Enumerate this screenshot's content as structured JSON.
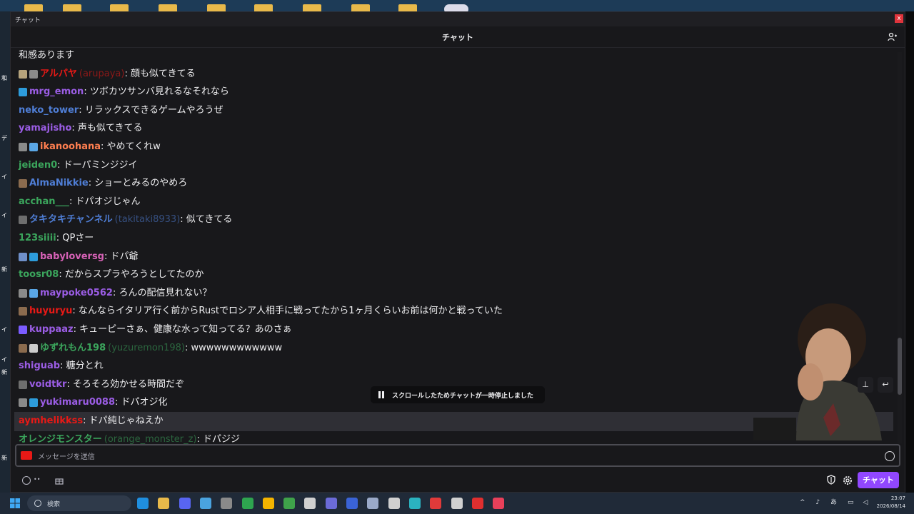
{
  "window": {
    "title": "チャット",
    "close_label": "x"
  },
  "header": {
    "title": "チャット"
  },
  "messages": [
    {
      "badges": [],
      "name": "",
      "alt": "",
      "text": "和感あります",
      "color": "#efeff1"
    },
    {
      "badges": [
        "#b6a37c",
        "#8a8a8a"
      ],
      "name": "アルパヤ",
      "alt": "(arupaya)",
      "text": ": 顔も似てきてる",
      "color": "#e91916"
    },
    {
      "badges": [
        "#2d9cdb"
      ],
      "name": "mrg_emon",
      "alt": "",
      "text": ": ツボカツサンバ見れるなそれなら",
      "color": "#9b5de5"
    },
    {
      "badges": [],
      "name": "neko_tower",
      "alt": "",
      "text": ": リラックスできるゲームやろうぜ",
      "color": "#4f7ed6"
    },
    {
      "badges": [],
      "name": "yamajisho",
      "alt": "",
      "text": ": 声も似てきてる",
      "color": "#9b5de5"
    },
    {
      "badges": [
        "#8a8a8a",
        "#5aa7e6"
      ],
      "name": "ikanoohana",
      "alt": "",
      "text": ": やめてくれw",
      "color": "#ff7f50"
    },
    {
      "badges": [],
      "name": "jeiden0",
      "alt": "",
      "text": ": ドーパミンジジイ",
      "color": "#3ba55c"
    },
    {
      "badges": [
        "#8b6b4e"
      ],
      "name": "AlmaNikkie",
      "alt": "",
      "text": ": ショーとみるのやめろ",
      "color": "#4f7ed6"
    },
    {
      "badges": [],
      "name": "acchan___",
      "alt": "",
      "text": ": ドパオジじゃん",
      "color": "#3ba55c"
    },
    {
      "badges": [
        "#6e6e6e"
      ],
      "name": "タキタキチャンネル",
      "alt": "(takitaki8933)",
      "text": ": 似てきてる",
      "color": "#4f7ed6"
    },
    {
      "badges": [],
      "name": "123siiii",
      "alt": "",
      "text": ": QPさー",
      "color": "#3ba55c"
    },
    {
      "badges": [
        "#6f8fc8",
        "#2d9cdb"
      ],
      "name": "babyloversg",
      "alt": "",
      "text": ": ドパ爺",
      "color": "#d561b5"
    },
    {
      "badges": [],
      "name": "toosr08",
      "alt": "",
      "text": ": だからスプラやろうとしてたのか",
      "color": "#3ba55c"
    },
    {
      "badges": [
        "#8a8a8a",
        "#5aa7e6"
      ],
      "name": "maypoke0562",
      "alt": "",
      "text": ": ろんの配信見れない？",
      "color": "#9b5de5"
    },
    {
      "badges": [
        "#8b6b4e"
      ],
      "name": "huyuryu",
      "alt": "",
      "text": ": なんならイタリア行く前からRustでロシア人相手に戦ってたから1ヶ月くらいお前は何かと戦っていた",
      "color": "#e91916"
    },
    {
      "badges": [
        "#7b5cff"
      ],
      "name": "kuppaaz",
      "alt": "",
      "text": ": キューピーさぁ、健康な水って知ってる？あのさぁ",
      "color": "#9b5de5"
    },
    {
      "badges": [
        "#8b6b4e",
        "#cccccc"
      ],
      "name": "ゆずれもん198",
      "alt": "(yuzuremon198)",
      "text": ": wwwwwwwwwwww",
      "color": "#3ba55c"
    },
    {
      "badges": [],
      "name": "shiguab",
      "alt": "",
      "text": ": 糖分とれ",
      "color": "#9b5de5"
    },
    {
      "badges": [
        "#6e6e6e"
      ],
      "name": "voidtkr",
      "alt": "",
      "text": ": そろそろ効かせる時間だぞ",
      "color": "#9b5de5"
    },
    {
      "badges": [
        "#8a8a8a",
        "#2d9cdb"
      ],
      "name": "yukimaru0088",
      "alt": "",
      "text": ": ドパオジ化",
      "color": "#9b5de5"
    },
    {
      "badges": [],
      "name": "aymhelikkss",
      "alt": "",
      "text": ": ドパ純じゃねえか",
      "color": "#e91916"
    },
    {
      "badges": [],
      "name": "オレンジモンスター",
      "alt": "(orange_monster_z)",
      "text": ": ドパジジ",
      "color": "#3ba55c"
    }
  ],
  "paused_notice": "スクロールしたためチャットが一時停止しました",
  "input": {
    "placeholder": "メッセージを送信"
  },
  "bottom": {
    "points_text": "••",
    "chat_button": "チャット"
  },
  "taskbar": {
    "search_label": "検索",
    "tray_ime": "あ",
    "time": "23:07",
    "date": "2026/08/14"
  },
  "left_strip_labels": [
    "和",
    "デ",
    "イ",
    "イ",
    "新",
    "イ",
    "イ",
    "新",
    "新"
  ]
}
